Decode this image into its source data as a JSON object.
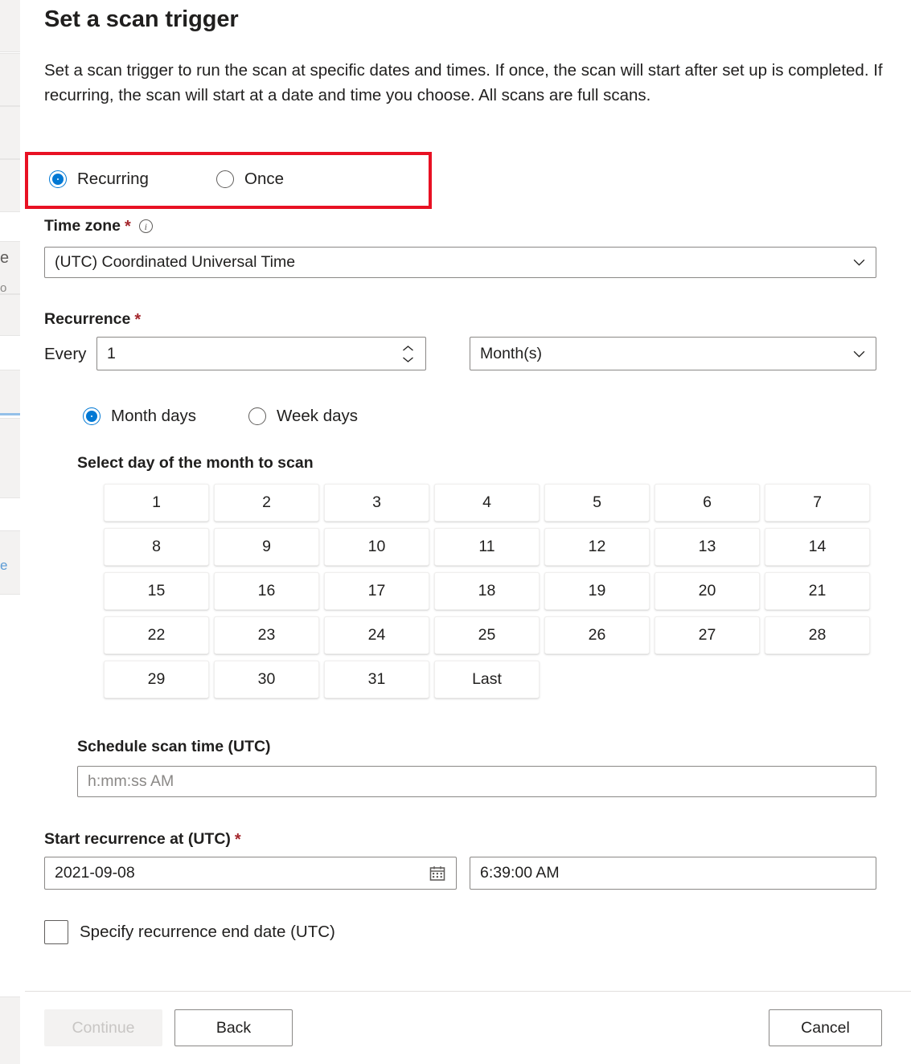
{
  "dialog": {
    "title": "Set a scan trigger",
    "description": "Set a scan trigger to run the scan at specific dates and times. If once, the scan will start after set up is completed. If recurring, the scan will start at a date and time you choose. All scans are full scans."
  },
  "trigger_type": {
    "highlighted": true,
    "highlight_color": "#e81123",
    "selected": "Recurring",
    "options": [
      {
        "label": "Recurring",
        "checked": true
      },
      {
        "label": "Once",
        "checked": false
      }
    ]
  },
  "time_zone": {
    "label": "Time zone",
    "required_marker": "*",
    "info_glyph": "i",
    "value": "(UTC) Coordinated Universal Time"
  },
  "recurrence": {
    "label": "Recurrence",
    "required_marker": "*",
    "every_label": "Every",
    "interval_value": "1",
    "unit_value": "Month(s)"
  },
  "day_mode": {
    "selected": "Month days",
    "options": [
      {
        "label": "Month days",
        "checked": true
      },
      {
        "label": "Week days",
        "checked": false
      }
    ]
  },
  "month_days": {
    "heading": "Select day of the month to scan",
    "cells": [
      "1",
      "2",
      "3",
      "4",
      "5",
      "6",
      "7",
      "8",
      "9",
      "10",
      "11",
      "12",
      "13",
      "14",
      "15",
      "16",
      "17",
      "18",
      "19",
      "20",
      "21",
      "22",
      "23",
      "24",
      "25",
      "26",
      "27",
      "28",
      "29",
      "30",
      "31",
      "Last"
    ]
  },
  "schedule_scan_time": {
    "label": "Schedule scan time (UTC)",
    "placeholder": "h:mm:ss AM",
    "value": ""
  },
  "start_recurrence": {
    "label": "Start recurrence at (UTC)",
    "required_marker": "*",
    "date_value": "2021-09-08",
    "time_value": "6:39:00 AM"
  },
  "end_date_checkbox": {
    "label": "Specify recurrence end date (UTC)",
    "checked": false
  },
  "footer": {
    "continue_label": "Continue",
    "continue_disabled": true,
    "back_label": "Back",
    "cancel_label": "Cancel"
  },
  "background_fragments": {
    "frag_1": "e",
    "frag_2": "o",
    "frag_3": "e"
  },
  "colors": {
    "accent": "#0078d4",
    "required": "#a4262c",
    "highlight": "#e81123",
    "text": "#201f1e",
    "placeholder": "#8a8886"
  }
}
